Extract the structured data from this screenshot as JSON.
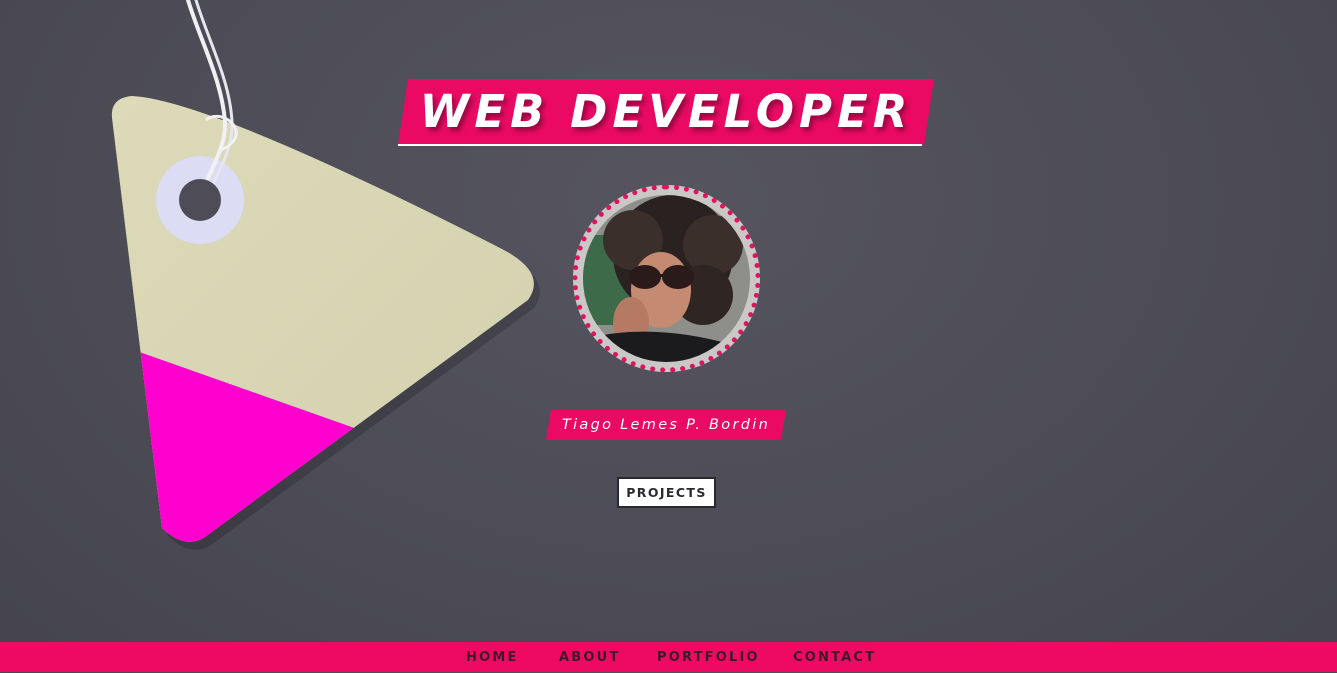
{
  "hero": {
    "title": "WEB DEVELOPER",
    "name": "Tiago Lemes P. Bordin",
    "projects_button": "PROJECTS"
  },
  "nav": {
    "items": [
      {
        "label": "HOME"
      },
      {
        "label": "ABOUT"
      },
      {
        "label": "PORTFOLIO"
      },
      {
        "label": "CONTACT"
      }
    ]
  },
  "colors": {
    "accent": "#ea0a63",
    "background": "#4e4d57",
    "tag_paper": "#d8d6b3",
    "tag_pink": "#ff00cf",
    "button_bg": "#ffffff",
    "nav_text": "#3e1828"
  },
  "icons": {
    "decoration": "gift-tag-illustration",
    "avatar": "profile-photo"
  }
}
